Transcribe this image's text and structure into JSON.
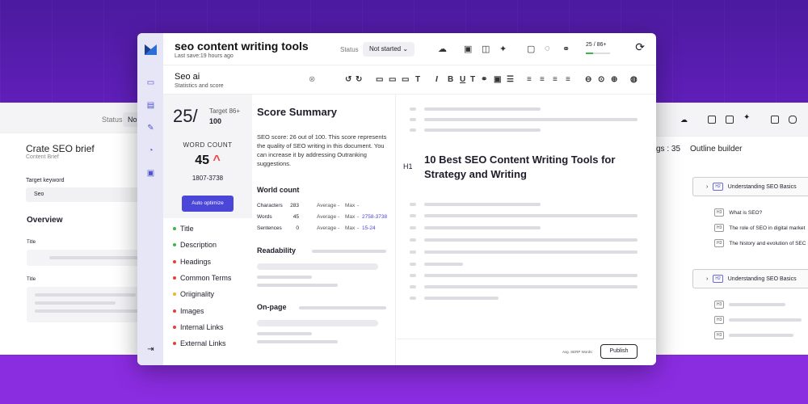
{
  "left_panel": {
    "status_label": "Status",
    "status_value": "No",
    "title": "Crate SEO brief",
    "subtitle": "Content Brief",
    "kw_label": "Target keyword",
    "kw_value": "Seo",
    "overview": "Overview",
    "field1": "Title",
    "field2": "Title"
  },
  "right_panel": {
    "ngrams": "gs : 35",
    "outline_title": "Outline builder",
    "h2_1": "Understanding SEO Basics",
    "sub_1": "What is SEO?",
    "sub_2": "The role of SEO in digital market",
    "sub_3": "The history and evolution of SEC",
    "h2_2": "Understanding SEO Basics",
    "h2_tag": "H2",
    "h3_tag": "H3"
  },
  "header": {
    "title": "seo content writing tools",
    "last_save": "Last save:19 hours ago",
    "status_label": "Status",
    "status_value": "Not started",
    "score": "25 / 86+",
    "score_fraction": 0.29
  },
  "toolbar": {
    "panel_title": "Seo ai",
    "panel_subtitle": "Statistics and score"
  },
  "score": {
    "value": "25/",
    "target_label": "Target 86+",
    "target_max": "100",
    "word_count_label": "WORD COUNT",
    "word_count": "45",
    "word_range": "1807-3738",
    "auto_btn": "Auto optimize"
  },
  "checklist": [
    {
      "label": "Title",
      "color": "#3fb64a"
    },
    {
      "label": "Description",
      "color": "#3fb64a"
    },
    {
      "label": "Headings",
      "color": "#e0413a"
    },
    {
      "label": "Common Terms",
      "color": "#e0413a"
    },
    {
      "label": "Oriiginality",
      "color": "#f0b429"
    },
    {
      "label": "Images",
      "color": "#e0413a"
    },
    {
      "label": "Internal Links",
      "color": "#e0413a"
    },
    {
      "label": "External Links",
      "color": "#e0413a"
    }
  ],
  "summary": {
    "title": "Score Summary",
    "text": "SEO score: 26 out of 100. This score represents the quality of SEO writing in this document. You can increase it by addressing Outranking suggestions.",
    "word_count_h": "World count",
    "rows": [
      {
        "k": "Characters",
        "v": "283",
        "a": "Average",
        "avg": "-",
        "m": "Max",
        "max": "-",
        "r": ""
      },
      {
        "k": "Words",
        "v": "45",
        "a": "Average",
        "avg": "-",
        "m": "Max",
        "max": "-",
        "r": "2758-3738"
      },
      {
        "k": "Sentences",
        "v": "0",
        "a": "Average",
        "avg": "-",
        "m": "Max",
        "max": "-",
        "r": "15-24"
      }
    ],
    "readability_h": "Readability",
    "onpage_h": "On-page"
  },
  "editor": {
    "h1_tag": "H1",
    "h1_text": "10 Best SEO Content Writing Tools for Strategy and Writing",
    "serp_label": "Avg. SERP Words:",
    "publish": "Publish"
  }
}
